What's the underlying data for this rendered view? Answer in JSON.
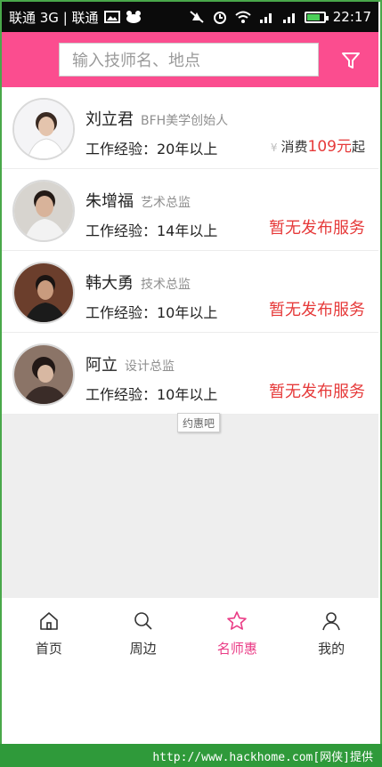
{
  "statusbar": {
    "carrier": "联通 3G | 联通",
    "time": "22:17"
  },
  "header": {
    "search_placeholder": "输入技师名、地点",
    "filter_icon": "filter-icon",
    "brand_color": "#fb4d8f"
  },
  "stylists": [
    {
      "name": "刘立君",
      "title": "BFH美学创始人",
      "experience": "工作经验：20年以上",
      "price_symbol": "¥",
      "price_label": "消费",
      "price_value": "109元",
      "price_suffix": "起"
    },
    {
      "name": "朱增福",
      "title": "艺术总监",
      "experience": "工作经验：14年以上",
      "status": "暂无发布服务"
    },
    {
      "name": "韩大勇",
      "title": "技术总监",
      "experience": "工作经验：10年以上",
      "status": "暂无发布服务"
    },
    {
      "name": "阿立",
      "title": "设计总监",
      "experience": "工作经验：10年以上",
      "status": "暂无发布服务"
    }
  ],
  "tooltip": "约惠吧",
  "tabs": [
    {
      "label": "首页",
      "icon": "home-icon"
    },
    {
      "label": "周边",
      "icon": "search-icon"
    },
    {
      "label": "名师惠",
      "icon": "star-icon",
      "active": true
    },
    {
      "label": "我的",
      "icon": "user-icon"
    }
  ],
  "accent_color": "#ea3c86",
  "footer_text": "http://www.hackhome.com[网侠]提供"
}
